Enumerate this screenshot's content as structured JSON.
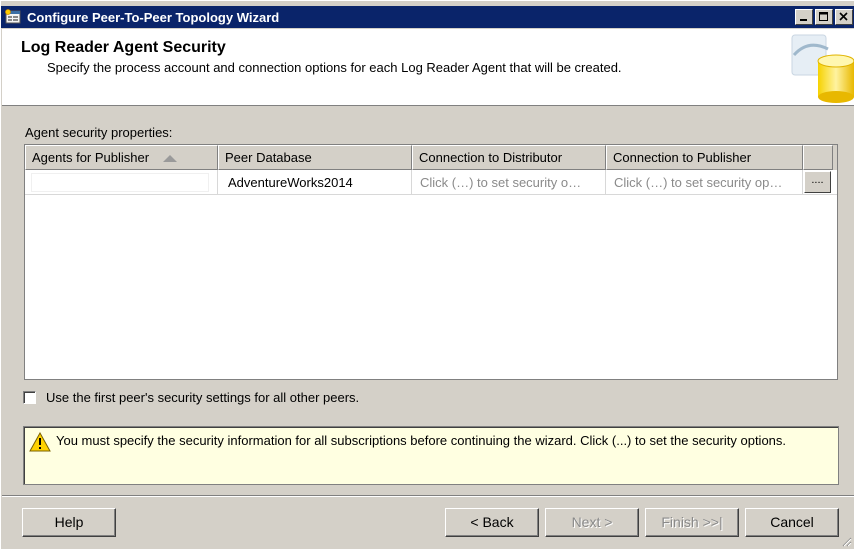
{
  "window": {
    "title": "Configure Peer-To-Peer Topology Wizard",
    "controls": {
      "minimize": "_",
      "maximize": "□",
      "close": "×"
    }
  },
  "header": {
    "title": "Log Reader Agent Security",
    "subtitle": "Specify the process account and connection options for each Log Reader Agent that will be created."
  },
  "section_label": "Agent security properties:",
  "grid": {
    "columns": [
      "Agents for Publisher",
      "Peer Database",
      "Connection to Distributor",
      "Connection to Publisher"
    ],
    "rows": [
      {
        "publisher": "",
        "peer_database": "AdventureWorks2014",
        "distributor": "Click (…) to set security o…",
        "publisher_conn": "Click (…) to set security op…",
        "button": "...."
      }
    ]
  },
  "checkbox_label": "Use the first peer's security settings for all other peers.",
  "warning": "You must specify the security information for all subscriptions before continuing the wizard. Click (...) to set the security options.",
  "buttons": {
    "help": "Help",
    "back": "< Back",
    "next": "Next >",
    "finish": "Finish >>|",
    "cancel": "Cancel"
  },
  "colors": {
    "titlebar": "#0a246a",
    "warning_bg": "#ffffe1",
    "window_bg": "#d4d0c8"
  }
}
